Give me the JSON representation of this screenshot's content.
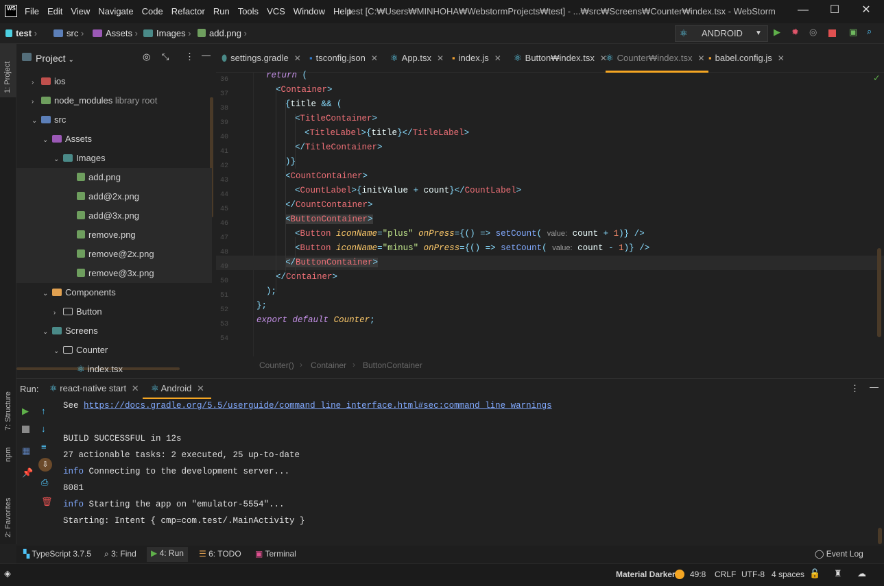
{
  "window": {
    "logo": "WS",
    "title": "test [C:₩Users₩MINHOHA₩WebstormProjects₩test] - ...₩src₩Screens₩Counter₩index.tsx - WebStorm",
    "menu": [
      "File",
      "Edit",
      "View",
      "Navigate",
      "Code",
      "Refactor",
      "Run",
      "Tools",
      "VCS",
      "Window",
      "Help"
    ]
  },
  "breadcrumb": [
    "test",
    "src",
    "Assets",
    "Images",
    "add.png"
  ],
  "run_config": "ANDROID",
  "left_strip": {
    "project": "1: Project",
    "structure": "7: Structure",
    "npm": "npm",
    "favorites": "2: Favorites"
  },
  "project_panel": {
    "title": "Project",
    "tree": [
      {
        "label": "ios",
        "note": ""
      },
      {
        "label": "node_modules",
        "note": "library root"
      },
      {
        "label": "src",
        "note": ""
      },
      {
        "label": "Assets",
        "note": ""
      },
      {
        "label": "Images",
        "note": ""
      },
      {
        "label": "add.png",
        "note": ""
      },
      {
        "label": "add@2x.png",
        "note": ""
      },
      {
        "label": "add@3x.png",
        "note": ""
      },
      {
        "label": "remove.png",
        "note": ""
      },
      {
        "label": "remove@2x.png",
        "note": ""
      },
      {
        "label": "remove@3x.png",
        "note": ""
      },
      {
        "label": "Components",
        "note": ""
      },
      {
        "label": "Button",
        "note": ""
      },
      {
        "label": "Screens",
        "note": ""
      },
      {
        "label": "Counter",
        "note": ""
      },
      {
        "label": "index.tsx",
        "note": ""
      }
    ]
  },
  "tabs": [
    {
      "label": "settings.gradle",
      "active": false
    },
    {
      "label": "tsconfig.json",
      "active": false
    },
    {
      "label": "App.tsx",
      "active": false
    },
    {
      "label": "index.js",
      "active": false
    },
    {
      "label": "Button₩index.tsx",
      "active": false
    },
    {
      "label": "Counter₩index.tsx",
      "active": true
    },
    {
      "label": "babel.config.js",
      "active": false
    }
  ],
  "editor": {
    "line_numbers": [
      "36",
      "37",
      "38",
      "39",
      "40",
      "41",
      "42",
      "43",
      "44",
      "45",
      "46",
      "47",
      "48",
      "49",
      "50",
      "51",
      "52",
      "53",
      "54"
    ],
    "current_line": "49",
    "code_breadcrumb": [
      "Counter()",
      "Container",
      "ButtonContainer"
    ]
  },
  "run_panel": {
    "label": "Run:",
    "tabs": [
      {
        "label": "react-native start",
        "active": false
      },
      {
        "label": "Android",
        "active": true
      }
    ],
    "console": {
      "see_prefix": "See ",
      "link": "https://docs.gradle.org/5.5/userguide/command_line_interface.html#sec:command_line_warnings",
      "lines": [
        {
          "prefix": "",
          "text": "BUILD SUCCESSFUL in 12s"
        },
        {
          "prefix": "",
          "text": "27 actionable tasks: 2 executed, 25 up-to-date"
        },
        {
          "prefix": "info",
          "text": " Connecting to the development server..."
        },
        {
          "prefix": "",
          "text": "8081"
        },
        {
          "prefix": "info",
          "text": " Starting the app on \"emulator-5554\"..."
        },
        {
          "prefix": "",
          "text": "Starting: Intent { cmp=com.test/.MainActivity }"
        }
      ]
    }
  },
  "tool_windows": {
    "typescript": "TypeScript 3.7.5",
    "find": "3: Find",
    "run": "4: Run",
    "todo": "6: TODO",
    "terminal": "Terminal",
    "event_log": "Event Log"
  },
  "status": {
    "theme": "Material Darker",
    "position": "49:8",
    "line_sep": "CRLF",
    "encoding": "UTF-8",
    "indent": "4 spaces"
  },
  "colors": {
    "accent": "#f5a623",
    "bg": "#212121",
    "keyword": "#c792ea",
    "tag": "#f07178",
    "string": "#c3e88d",
    "attr": "#ffcb6b",
    "punct": "#89ddff",
    "link": "#82aaff"
  }
}
